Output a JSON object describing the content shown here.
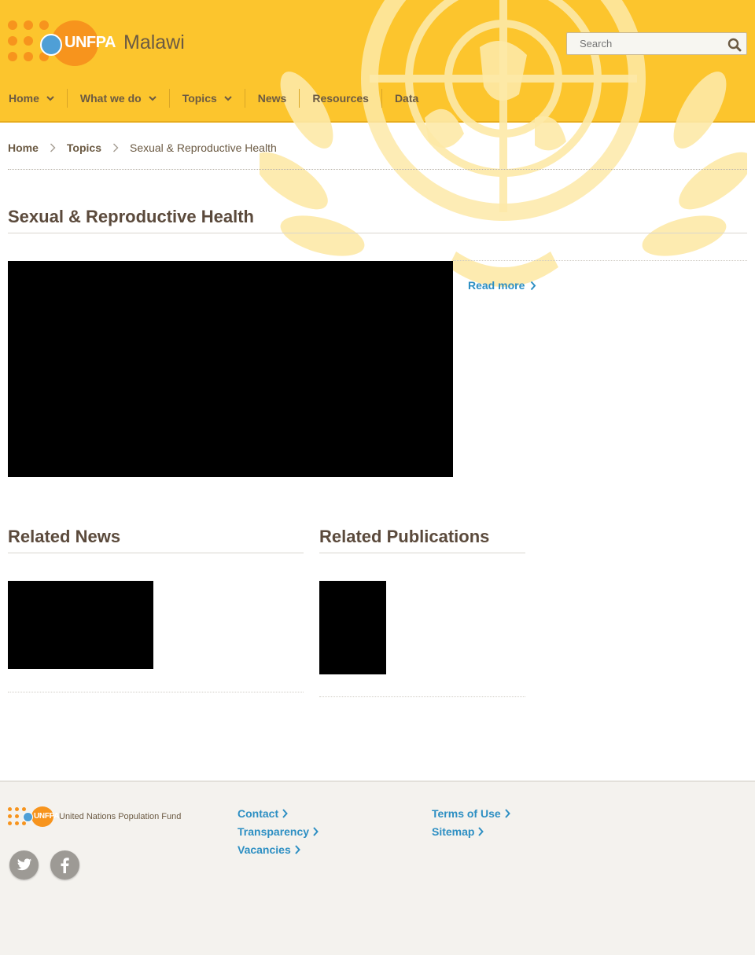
{
  "site": {
    "logo_text": "UNFPA",
    "country": "Malawi"
  },
  "search": {
    "placeholder": "Search"
  },
  "nav": {
    "items": [
      {
        "label": "Home"
      },
      {
        "label": "What we do"
      },
      {
        "label": "Topics"
      },
      {
        "label": "News"
      },
      {
        "label": "Resources"
      },
      {
        "label": "Data"
      }
    ]
  },
  "breadcrumb": {
    "home": "Home",
    "topics": "Topics",
    "current": "Sexual & Reproductive Health"
  },
  "page": {
    "title": "Sexual & Reproductive Health",
    "read_more": "Read more"
  },
  "sections": {
    "related_news": "Related News",
    "related_publications": "Related Publications"
  },
  "footer": {
    "logo_text": "UNFPA",
    "org_name": "United Nations Population Fund",
    "links_col1": [
      "Contact",
      "Transparency",
      "Vacancies"
    ],
    "links_col2": [
      "Terms of Use",
      "Sitemap"
    ]
  },
  "colors": {
    "header_bg": "#fcc52d",
    "brand_orange": "#f7941d",
    "link_blue": "#2d8fc3",
    "text_brown": "#5b4a3c",
    "footer_bg": "#f4f2ee"
  },
  "icons": {
    "search": "search-icon",
    "chevron_down": "chevron-down-icon",
    "chevron_right": "chevron-right-icon",
    "twitter": "twitter-icon",
    "facebook": "facebook-icon",
    "emblem": "un-emblem-icon"
  }
}
